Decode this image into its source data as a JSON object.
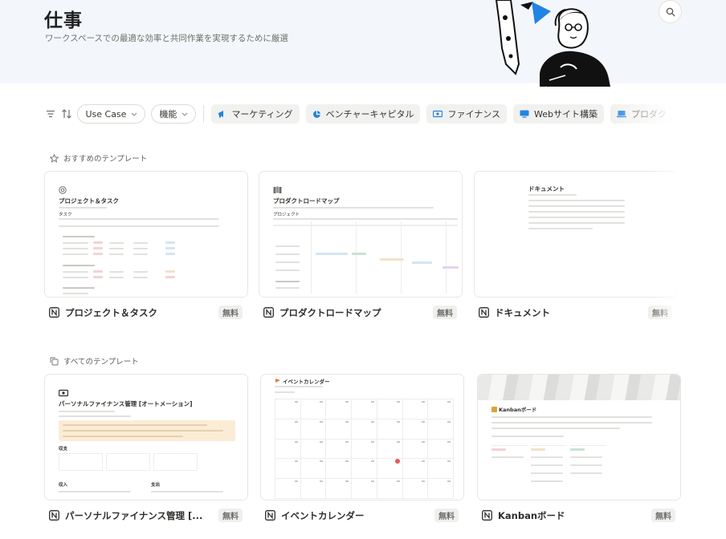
{
  "header": {
    "title": "仕事",
    "subtitle": "ワークスペースでの最適な効率と共同作業を実現するために厳選"
  },
  "filters": {
    "use_case_label": "Use Case",
    "feature_label": "機能",
    "categories": [
      {
        "label": "マーケティング",
        "icon": "megaphone-icon"
      },
      {
        "label": "ベンチャーキャピタル",
        "icon": "pie-chart-icon"
      },
      {
        "label": "ファイナンス",
        "icon": "money-icon"
      },
      {
        "label": "Webサイト構築",
        "icon": "monitor-icon"
      },
      {
        "label": "プロダク",
        "icon": "laptop-icon"
      }
    ]
  },
  "featured": {
    "heading": "おすすめのテンプレート",
    "cards": [
      {
        "name": "プロジェクト＆タスク",
        "price": "無料",
        "preview_title": "プロジェクト＆タスク",
        "preview_sub": "タスク"
      },
      {
        "name": "プロダクトロードマップ",
        "price": "無料",
        "preview_title": "プロダクトロードマップ",
        "preview_sub": "プロジェクト"
      },
      {
        "name": "ドキュメント",
        "price": "無料",
        "preview_title": "ドキュメント",
        "preview_sub": ""
      }
    ]
  },
  "all": {
    "heading": "すべてのテンプレート",
    "cards": [
      {
        "name": "パーソナルファイナンス管理 [...",
        "price": "無料",
        "preview_title": "パーソナルファイナンス管理 [オートメーション]",
        "preview_sub_a": "収支",
        "preview_sub_b": "収入",
        "preview_sub_c": "支出"
      },
      {
        "name": "イベントカレンダー",
        "price": "無料",
        "preview_title": "イベントカレンダー"
      },
      {
        "name": "Kanbanボード",
        "price": "無料",
        "preview_title": "Kanbanボード"
      }
    ]
  },
  "colors": {
    "hero_bg": "#f3f7fb",
    "accent_blue": "#2383e2",
    "callout_bg": "#fbecd6"
  }
}
